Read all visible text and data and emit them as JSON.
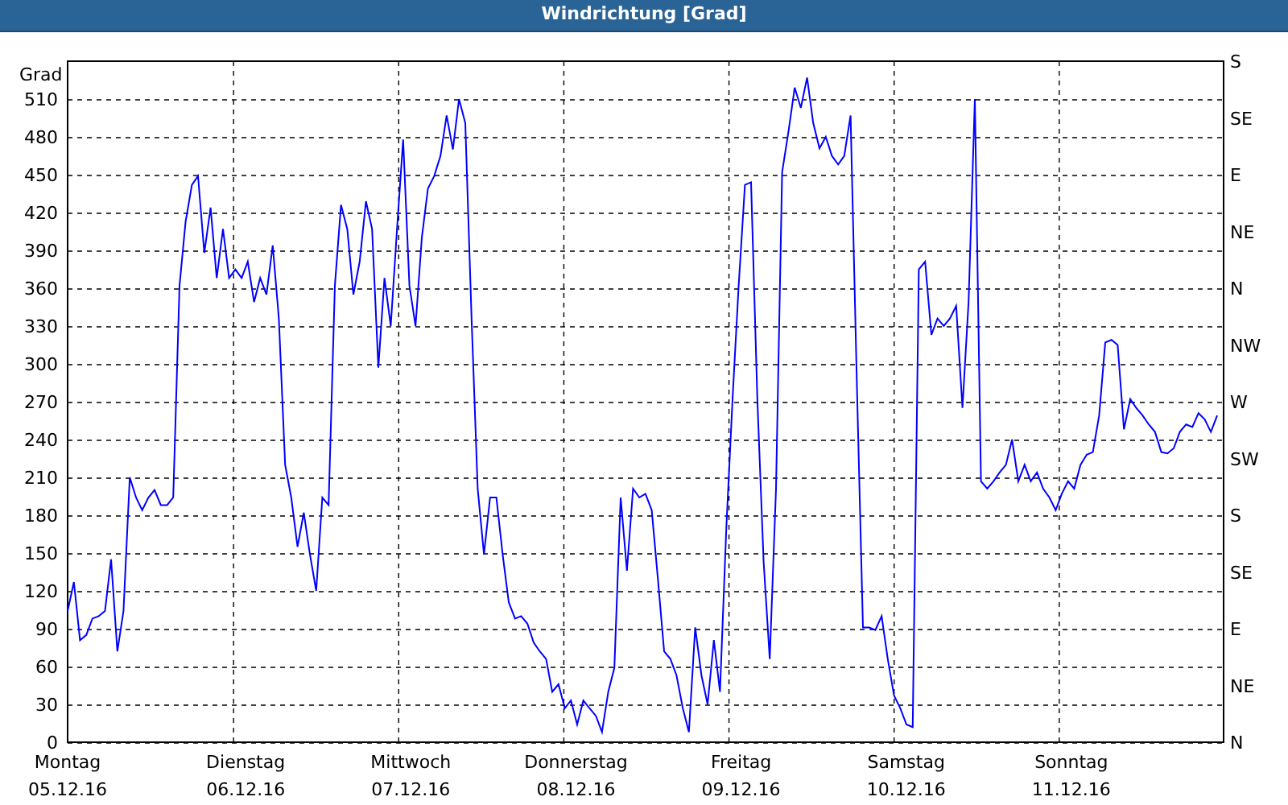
{
  "window": {
    "title": "Windrichtung [Grad]"
  },
  "chart": {
    "right_axis_labels": [
      "S",
      "SE",
      "E",
      "NE",
      "N",
      "NW",
      "W",
      "SW",
      "S",
      "SE",
      "E",
      "NE",
      "N"
    ],
    "x_axis_labels": [
      {
        "day": "Montag",
        "date": "05.12.16"
      },
      {
        "day": "Dienstag",
        "date": "06.12.16"
      },
      {
        "day": "Mittwoch",
        "date": "07.12.16"
      },
      {
        "day": "Donnerstag",
        "date": "08.12.16"
      },
      {
        "day": "Freitag",
        "date": "09.12.16"
      },
      {
        "day": "Samstag",
        "date": "10.12.16"
      },
      {
        "day": "Sonntag",
        "date": "11.12.16"
      }
    ],
    "chart_data": {
      "type": "line",
      "ylabel": "Grad",
      "ylim": [
        0,
        540
      ],
      "grid": true,
      "yticks": [
        0,
        30,
        60,
        90,
        120,
        150,
        180,
        210,
        240,
        270,
        300,
        330,
        360,
        390,
        420,
        450,
        480,
        510
      ],
      "series": [
        {
          "color": "#0000ff",
          "values": [
            104,
            127,
            81,
            85,
            98,
            100,
            104,
            145,
            72,
            104,
            210,
            194,
            184,
            194,
            200,
            188,
            188,
            194,
            362,
            413,
            442,
            449,
            388,
            424,
            368,
            407,
            368,
            375,
            368,
            381,
            349,
            368,
            355,
            394,
            336,
            220,
            194,
            155,
            182,
            149,
            120,
            194,
            188,
            362,
            426,
            407,
            355,
            381,
            429,
            407,
            297,
            368,
            330,
            407,
            478,
            362,
            330,
            400,
            439,
            449,
            465,
            497,
            470,
            510,
            491,
            336,
            201,
            149,
            194,
            194,
            149,
            111,
            98,
            100,
            94,
            79,
            72,
            66,
            40,
            46,
            27,
            33,
            14,
            33,
            27,
            21,
            8,
            40,
            59,
            194,
            136,
            201,
            194,
            197,
            184,
            130,
            72,
            66,
            53,
            27,
            8,
            91,
            53,
            30,
            81,
            40,
            169,
            272,
            362,
            442,
            444,
            272,
            143,
            66,
            201,
            452,
            484,
            519,
            503,
            527,
            491,
            471,
            480,
            465,
            458,
            465,
            497,
            285,
            91,
            91,
            89,
            100,
            66,
            37,
            27,
            14,
            12,
            375,
            381,
            323,
            336,
            330,
            336,
            346,
            265,
            349,
            510,
            207,
            201,
            207,
            214,
            220,
            240,
            207,
            220,
            207,
            214,
            201,
            194,
            184,
            197,
            207,
            201,
            220,
            228,
            230,
            259,
            317,
            319,
            315,
            248,
            272,
            265,
            259,
            252,
            246,
            230,
            229,
            233,
            246,
            252,
            250,
            261,
            256,
            246,
            259
          ]
        }
      ]
    }
  }
}
